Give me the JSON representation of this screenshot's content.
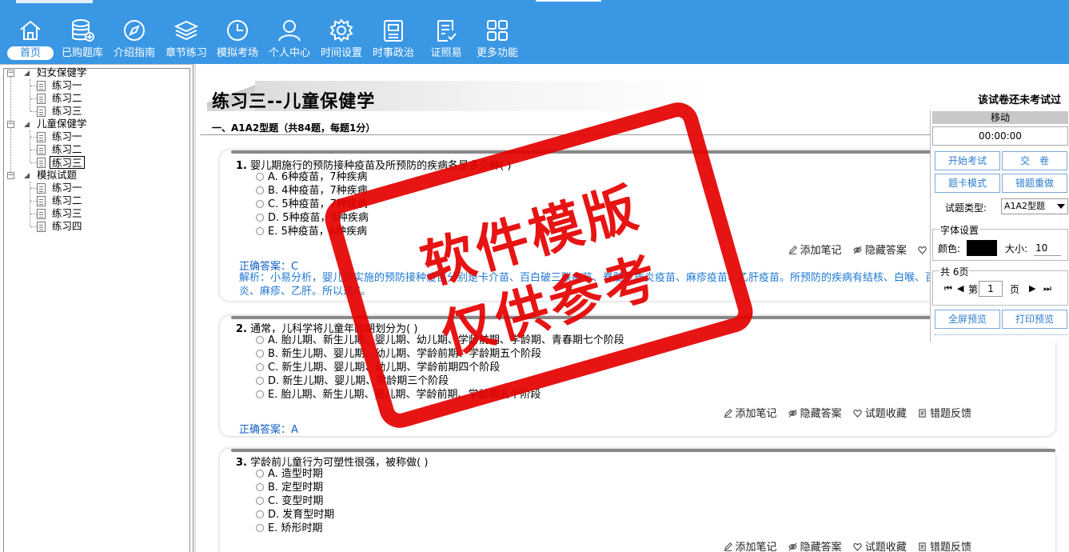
{
  "colors": {
    "toolbar_bg": "#3a97e4",
    "accent": "#2f86d6",
    "answer_text": "#1060c8",
    "stamp_red": "#e50000"
  },
  "toolbar": {
    "items": [
      {
        "label": "首页",
        "icon": "home-icon",
        "active": true
      },
      {
        "label": "已购题库",
        "icon": "database-icon"
      },
      {
        "label": "介绍指南",
        "icon": "compass-icon"
      },
      {
        "label": "章节练习",
        "icon": "layers-icon"
      },
      {
        "label": "模拟考场",
        "icon": "clock-icon"
      },
      {
        "label": "个人中心",
        "icon": "user-icon"
      },
      {
        "label": "时间设置",
        "icon": "gear-icon"
      },
      {
        "label": "时事政治",
        "icon": "news-icon"
      },
      {
        "label": "证照易",
        "icon": "checklist-icon"
      },
      {
        "label": "更多功能",
        "icon": "grid-icon"
      }
    ]
  },
  "tree": {
    "groups": [
      {
        "label": "妇女保健学",
        "children": [
          "练习一",
          "练习二",
          "练习三"
        ]
      },
      {
        "label": "儿童保健学",
        "children": [
          "练习一",
          "练习二",
          "练习三"
        ],
        "selected_index": 2
      },
      {
        "label": "模拟试题",
        "children": [
          "练习一",
          "练习二",
          "练习三",
          "练习四"
        ]
      }
    ]
  },
  "main": {
    "title": "练习三--儿童保健学",
    "exam_status": "该试卷还未考试过",
    "section_title": "一、A1A2型题（共84题，每题1分）",
    "actions": {
      "note": "添加笔记",
      "hide_answer": "隐藏答案",
      "favorite": "试题收藏",
      "feedback": "错题反馈"
    },
    "questions": [
      {
        "number": "1.",
        "text": "婴儿期施行的预防接种疫苗及所预防的疾病各是多少种( )",
        "options": [
          "A. 6种疫苗，7种疾病",
          "B. 4种疫苗，7种疾病",
          "C. 5种疫苗，7种疾病",
          "D. 5种疫苗，8种疾病",
          "E. 5种疫苗，6种疾病"
        ],
        "answer": "正确答案：C",
        "analysis": "解析：小易分析，婴儿期实施的预防接种疫苗分别是卡介苗、百白破三联疫苗、脊髓灰质炎疫苗、麻疹疫苗、乙肝疫苗。所预防的疾病有结核、白喉、百日咳、破伤风、脊髓灰质炎、麻疹、乙肝。所以选C。"
      },
      {
        "number": "2.",
        "text": "通常，儿科学将儿童年龄期划分为( )",
        "options": [
          "A. 胎儿期、新生儿期、婴儿期、幼儿期、学龄前期、学龄期、青春期七个阶段",
          "B. 新生儿期、婴儿期、幼儿期、学龄前期、学龄期五个阶段",
          "C. 新生儿期、婴儿期、幼儿期、学龄前期四个阶段",
          "D. 新生儿期、婴儿期、学龄期三个阶段",
          "E. 胎儿期、新生儿期、婴儿期、学龄前期、学龄期五个阶段"
        ],
        "answer": "正确答案：A"
      },
      {
        "number": "3.",
        "text": "学龄前儿童行为可塑性很强，被称做( )",
        "options": [
          "A. 造型时期",
          "B. 定型时期",
          "C. 变型时期",
          "D. 发育型时期",
          "E. 矫形时期"
        ]
      }
    ]
  },
  "control_panel": {
    "move_label": "移动",
    "timer": "00:00:00",
    "start_exam": "开始考试",
    "submit": "交　卷",
    "card_mode": "题卡模式",
    "redo_wrong": "错题重做",
    "type_label": "试题类型:",
    "type_value": "A1A2型题",
    "font_legend": "字体设置",
    "color_label": "颜色:",
    "color_value": "#000000",
    "size_label": "大小:",
    "size_value": "10",
    "pages_legend": "共 6页",
    "page_prefix": "第",
    "page_value": "1",
    "page_suffix": "页",
    "fullscreen_preview": "全屏预览",
    "print_preview": "打印预览"
  },
  "watermark": {
    "line1": "软件模版",
    "line2": "仅供参考"
  }
}
